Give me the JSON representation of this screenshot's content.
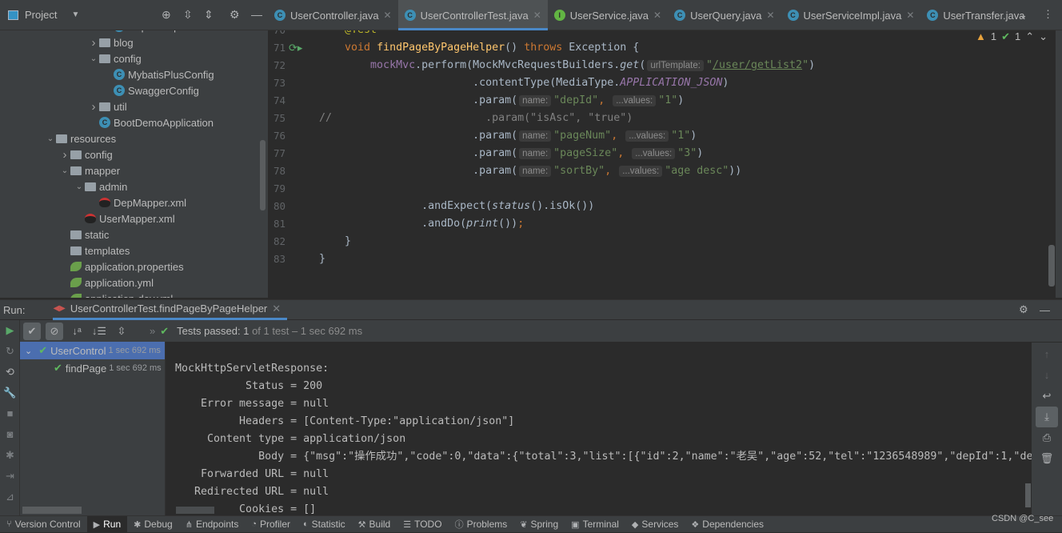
{
  "project_panel": {
    "title": "Project",
    "tree": [
      {
        "level": 7,
        "arrow": "none",
        "icon": "class",
        "label": "DepExample"
      },
      {
        "level": 6,
        "arrow": "closed",
        "icon": "folder",
        "label": "blog"
      },
      {
        "level": 6,
        "arrow": "open",
        "icon": "folder",
        "label": "config"
      },
      {
        "level": 7,
        "arrow": "none",
        "icon": "class",
        "label": "MybatisPlusConfig"
      },
      {
        "level": 7,
        "arrow": "none",
        "icon": "class",
        "label": "SwaggerConfig"
      },
      {
        "level": 6,
        "arrow": "closed",
        "icon": "folder",
        "label": "util"
      },
      {
        "level": 6,
        "arrow": "none",
        "icon": "class",
        "label": "BootDemoApplication"
      },
      {
        "level": 3,
        "arrow": "open",
        "icon": "folder",
        "label": "resources"
      },
      {
        "level": 4,
        "arrow": "closed",
        "icon": "folder",
        "label": "config"
      },
      {
        "level": 4,
        "arrow": "open",
        "icon": "folder",
        "label": "mapper"
      },
      {
        "level": 5,
        "arrow": "open",
        "icon": "folder",
        "label": "admin"
      },
      {
        "level": 6,
        "arrow": "none",
        "icon": "mybatis-xml",
        "label": "DepMapper.xml"
      },
      {
        "level": 5,
        "arrow": "none",
        "icon": "mybatis-xml",
        "label": "UserMapper.xml"
      },
      {
        "level": 4,
        "arrow": "none",
        "icon": "folder",
        "label": "static"
      },
      {
        "level": 4,
        "arrow": "none",
        "icon": "folder",
        "label": "templates"
      },
      {
        "level": 4,
        "arrow": "none",
        "icon": "spring-config",
        "label": "application.properties"
      },
      {
        "level": 4,
        "arrow": "none",
        "icon": "spring-config",
        "label": "application.yml"
      },
      {
        "level": 4,
        "arrow": "none",
        "icon": "spring-config",
        "label": "application-dev.yml"
      }
    ]
  },
  "editor_tabs": [
    {
      "label": "UserController.java",
      "icon": "class",
      "active": false
    },
    {
      "label": "UserControllerTest.java",
      "icon": "class",
      "active": true
    },
    {
      "label": "UserService.java",
      "icon": "interface",
      "active": false
    },
    {
      "label": "UserQuery.java",
      "icon": "class",
      "active": false
    },
    {
      "label": "UserServiceImpl.java",
      "icon": "class",
      "active": false
    },
    {
      "label": "UserTransfer.java",
      "icon": "class",
      "active": false
    }
  ],
  "inspections": {
    "warnings": "1",
    "ok": "1"
  },
  "code": [
    {
      "n": "70",
      "tokens": [
        [
          "    ",
          ""
        ],
        [
          "@Test",
          "an"
        ]
      ]
    },
    {
      "n": "71",
      "tokens": [
        [
          "    ",
          ""
        ],
        [
          "void ",
          "kw"
        ],
        [
          "findPageByPageHelper",
          "fn"
        ],
        [
          "() ",
          ""
        ],
        [
          "throws ",
          "kw"
        ],
        [
          "Exception {",
          ""
        ]
      ]
    },
    {
      "n": "72",
      "tokens": [
        [
          "        ",
          ""
        ],
        [
          "mockMvc",
          "fld"
        ],
        [
          ".perform(MockMvcRequestBuilders.",
          ""
        ],
        [
          "get",
          "it"
        ],
        [
          "(",
          ""
        ],
        [
          "urlTemplate:",
          "hint"
        ],
        [
          "\"",
          "st"
        ],
        [
          "/user/getList2",
          "stu"
        ],
        [
          "\"",
          "st"
        ],
        [
          ")",
          ""
        ]
      ]
    },
    {
      "n": "73",
      "tokens": [
        [
          "                        .contentType(MediaType.",
          ""
        ],
        [
          "APPLICATION_JSON",
          "cst"
        ],
        [
          ")",
          ""
        ]
      ]
    },
    {
      "n": "74",
      "tokens": [
        [
          "                        .param(",
          ""
        ],
        [
          "name:",
          "hint"
        ],
        [
          "\"depId\"",
          "st"
        ],
        [
          ", ",
          "kw"
        ],
        [
          "...values:",
          "hint"
        ],
        [
          "\"1\"",
          "st"
        ],
        [
          ")",
          ""
        ]
      ]
    },
    {
      "n": "75",
      "tokens": [
        [
          "//                        .param(\"isAsc\", \"true\")",
          "cm"
        ]
      ]
    },
    {
      "n": "76",
      "tokens": [
        [
          "                        .param(",
          ""
        ],
        [
          "name:",
          "hint"
        ],
        [
          "\"pageNum\"",
          "st"
        ],
        [
          ", ",
          "kw"
        ],
        [
          "...values:",
          "hint"
        ],
        [
          "\"1\"",
          "st"
        ],
        [
          ")",
          ""
        ]
      ]
    },
    {
      "n": "77",
      "tokens": [
        [
          "                        .param(",
          ""
        ],
        [
          "name:",
          "hint"
        ],
        [
          "\"pageSize\"",
          "st"
        ],
        [
          ", ",
          "kw"
        ],
        [
          "...values:",
          "hint"
        ],
        [
          "\"3\"",
          "st"
        ],
        [
          ")",
          ""
        ]
      ]
    },
    {
      "n": "78",
      "tokens": [
        [
          "                        .param(",
          ""
        ],
        [
          "name:",
          "hint"
        ],
        [
          "\"sortBy\"",
          "st"
        ],
        [
          ", ",
          "kw"
        ],
        [
          "...values:",
          "hint"
        ],
        [
          "\"age desc\"",
          "st"
        ],
        [
          "))",
          ""
        ]
      ]
    },
    {
      "n": "79",
      "tokens": []
    },
    {
      "n": "80",
      "tokens": [
        [
          "                .andExpect(",
          ""
        ],
        [
          "status",
          "it"
        ],
        [
          "().isOk())",
          ""
        ]
      ]
    },
    {
      "n": "81",
      "tokens": [
        [
          "                .andDo(",
          ""
        ],
        [
          "print",
          "it"
        ],
        [
          "())",
          ""
        ],
        [
          ";",
          "kw"
        ]
      ]
    },
    {
      "n": "82",
      "tokens": [
        [
          "    }",
          ""
        ]
      ]
    },
    {
      "n": "83",
      "tokens": [
        [
          "}",
          ""
        ]
      ]
    }
  ],
  "run_panel": {
    "label": "Run:",
    "tab": "UserControllerTest.findPageByPageHelper",
    "status_bold": "Tests passed: 1",
    "status_rest": " of 1 test – 1 sec 692 ms",
    "tests": [
      {
        "name": "UserControl",
        "duration": "1 sec 692 ms",
        "selected": true
      },
      {
        "name": "findPage",
        "duration": "1 sec 692 ms",
        "selected": false
      }
    ],
    "console": [
      "",
      "MockHttpServletResponse:",
      "           Status = 200",
      "    Error message = null",
      "          Headers = [Content-Type:\"application/json\"]",
      "     Content type = application/json",
      "             Body = {\"msg\":\"操作成功\",\"code\":0,\"data\":{\"total\":3,\"list\":[{\"id\":2,\"name\":\"老吴\",\"age\":52,\"tel\":\"1236548989\",\"depId\":1,\"depName\":",
      "    Forwarded URL = null",
      "   Redirected URL = null",
      "          Cookies = []"
    ]
  },
  "status_bar": [
    {
      "label": "Version Control",
      "icon": "⑂"
    },
    {
      "label": "Run",
      "icon": "▶",
      "active": true
    },
    {
      "label": "Debug",
      "icon": "✱"
    },
    {
      "label": "Endpoints",
      "icon": "⋔"
    },
    {
      "label": "Profiler",
      "icon": "◔"
    },
    {
      "label": "Statistic",
      "icon": "◐"
    },
    {
      "label": "Build",
      "icon": "⚒"
    },
    {
      "label": "TODO",
      "icon": "☰"
    },
    {
      "label": "Problems",
      "icon": "ⓘ"
    },
    {
      "label": "Spring",
      "icon": "❦"
    },
    {
      "label": "Terminal",
      "icon": "▣"
    },
    {
      "label": "Services",
      "icon": "◆"
    },
    {
      "label": "Dependencies",
      "icon": "❖"
    }
  ],
  "watermark": "CSDN @C_see"
}
